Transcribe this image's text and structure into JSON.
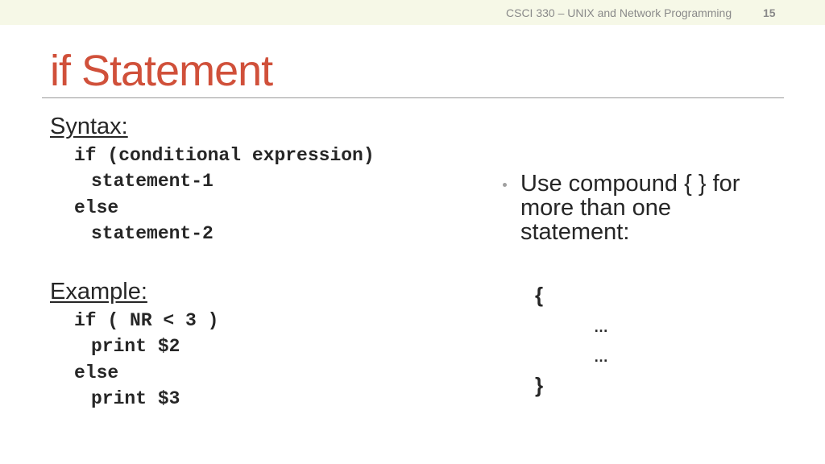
{
  "header": {
    "course": "CSCI 330 – UNIX and Network Programming",
    "page_number": "15"
  },
  "slide": {
    "title": "if Statement",
    "syntax": {
      "heading": "Syntax:",
      "lines": [
        "if (conditional expression)",
        "statement-1",
        "else",
        "statement-2"
      ]
    },
    "example": {
      "heading": "Example:",
      "lines": [
        "if ( NR < 3 )",
        "print $2",
        "else",
        "print $3"
      ]
    },
    "bullet": {
      "text": "Use compound  { } for more than one statement:"
    },
    "compound": {
      "open": "{",
      "line1": "…",
      "line2": "…",
      "close": "}"
    }
  }
}
